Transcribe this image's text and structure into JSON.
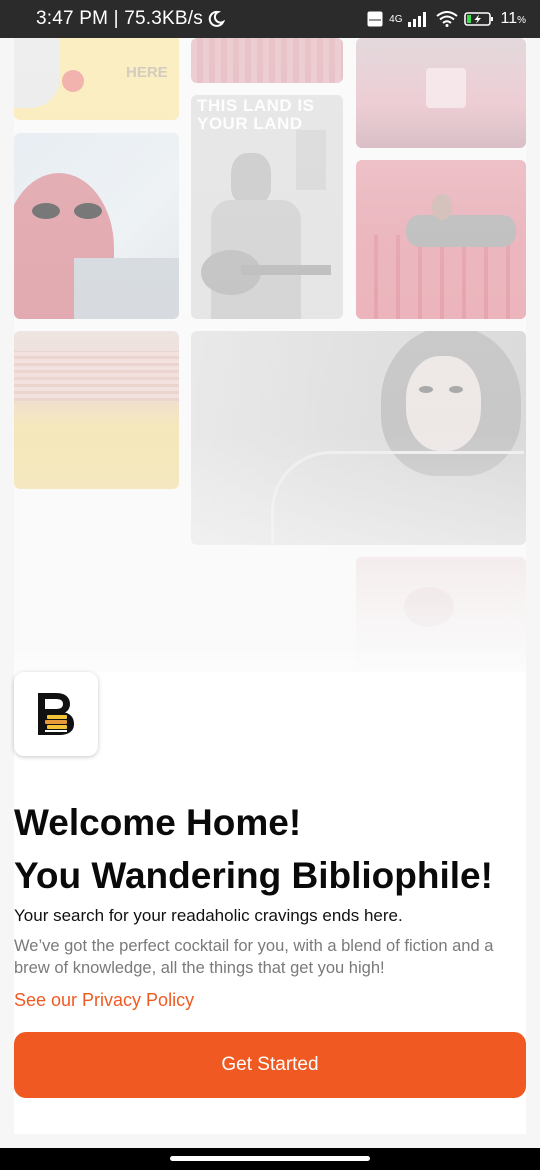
{
  "status_bar": {
    "time": "3:47 PM | 75.3KB/s",
    "dnd_icon": "moon-icon",
    "volte": "Vo LTE",
    "network": "4G",
    "battery_percent": "11",
    "battery_unit": "%"
  },
  "collage": {
    "poster_text_top": "HERE",
    "poster_text_guitar": "THIS LAND IS YOUR LAND"
  },
  "logo": {
    "icon": "bibliophile-b-logo-icon"
  },
  "welcome": {
    "line1": "Welcome Home!",
    "line2": "You Wandering Bibliophile!",
    "tagline": "Your search for your readaholic cravings ends here.",
    "description": "We’ve got the perfect cocktail for you, with a blend of fiction and a brew of knowledge, all the things that get you high!",
    "privacy_link": "See our Privacy Policy",
    "cta_label": "Get Started"
  },
  "colors": {
    "accent": "#f05a22",
    "status_bar": "#2b2b2b"
  }
}
